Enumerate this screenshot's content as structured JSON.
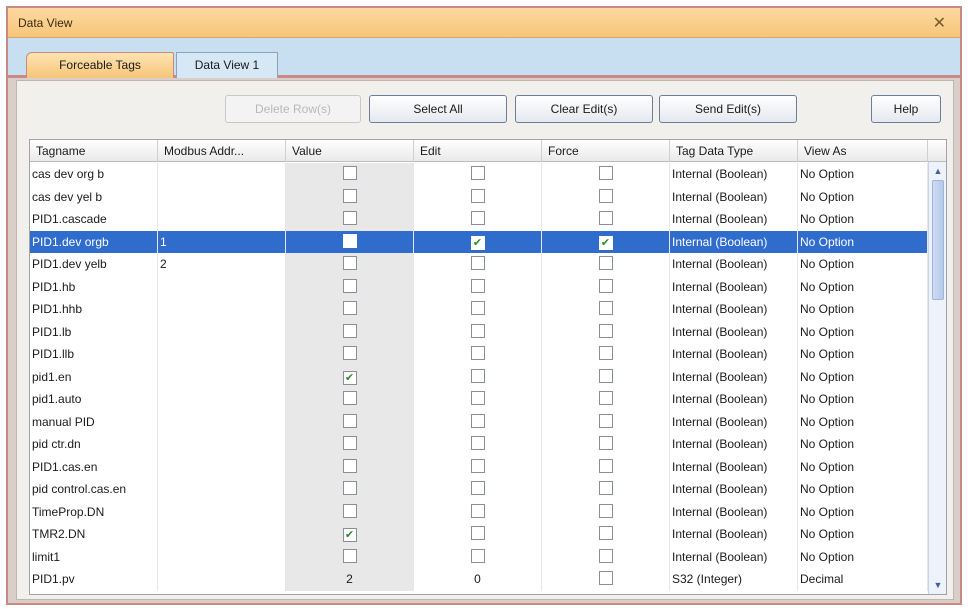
{
  "window": {
    "title": "Data View",
    "close_glyph": "✕"
  },
  "tabs": [
    {
      "label": "Forceable Tags"
    },
    {
      "label": "Data View 1"
    }
  ],
  "toolbar": {
    "delete_label": "Delete Row(s)",
    "select_all_label": "Select All",
    "clear_label": "Clear Edit(s)",
    "send_label": "Send Edit(s)",
    "help_label": "Help"
  },
  "table": {
    "columns": [
      "Tagname",
      "Modbus Addr...",
      "Value",
      "Edit",
      "Force",
      "Tag Data Type",
      "View As"
    ],
    "rows": [
      {
        "tag": "cas dev org b",
        "addr": "",
        "value": false,
        "edit": false,
        "force": false,
        "type": "Internal (Boolean)",
        "view": "No Option"
      },
      {
        "tag": "cas dev yel b",
        "addr": "",
        "value": false,
        "edit": false,
        "force": false,
        "type": "Internal (Boolean)",
        "view": "No Option"
      },
      {
        "tag": "PID1.cascade",
        "addr": "",
        "value": false,
        "edit": false,
        "force": false,
        "type": "Internal (Boolean)",
        "view": "No Option"
      },
      {
        "tag": "PID1.dev orgb",
        "addr": "1",
        "value": false,
        "edit": true,
        "force": true,
        "type": "Internal (Boolean)",
        "view": "No Option",
        "selected": true
      },
      {
        "tag": "PID1.dev yelb",
        "addr": "2",
        "value": false,
        "edit": false,
        "force": false,
        "type": "Internal (Boolean)",
        "view": "No Option"
      },
      {
        "tag": "PID1.hb",
        "addr": "",
        "value": false,
        "edit": false,
        "force": false,
        "type": "Internal (Boolean)",
        "view": "No Option"
      },
      {
        "tag": "PID1.hhb",
        "addr": "",
        "value": false,
        "edit": false,
        "force": false,
        "type": "Internal (Boolean)",
        "view": "No Option"
      },
      {
        "tag": "PID1.lb",
        "addr": "",
        "value": false,
        "edit": false,
        "force": false,
        "type": "Internal (Boolean)",
        "view": "No Option"
      },
      {
        "tag": "PID1.llb",
        "addr": "",
        "value": false,
        "edit": false,
        "force": false,
        "type": "Internal (Boolean)",
        "view": "No Option"
      },
      {
        "tag": "pid1.en",
        "addr": "",
        "value": true,
        "edit": false,
        "force": false,
        "type": "Internal (Boolean)",
        "view": "No Option"
      },
      {
        "tag": "pid1.auto",
        "addr": "",
        "value": false,
        "edit": false,
        "force": false,
        "type": "Internal (Boolean)",
        "view": "No Option"
      },
      {
        "tag": "manual PID",
        "addr": "",
        "value": false,
        "edit": false,
        "force": false,
        "type": "Internal (Boolean)",
        "view": "No Option"
      },
      {
        "tag": "pid ctr.dn",
        "addr": "",
        "value": false,
        "edit": false,
        "force": false,
        "type": "Internal (Boolean)",
        "view": "No Option"
      },
      {
        "tag": "PID1.cas.en",
        "addr": "",
        "value": false,
        "edit": false,
        "force": false,
        "type": "Internal (Boolean)",
        "view": "No Option"
      },
      {
        "tag": "pid control.cas.en",
        "addr": "",
        "value": false,
        "edit": false,
        "force": false,
        "type": "Internal (Boolean)",
        "view": "No Option"
      },
      {
        "tag": "TimeProp.DN",
        "addr": "",
        "value": false,
        "edit": false,
        "force": false,
        "type": "Internal (Boolean)",
        "view": "No Option"
      },
      {
        "tag": "TMR2.DN",
        "addr": "",
        "value": true,
        "edit": false,
        "force": false,
        "type": "Internal (Boolean)",
        "view": "No Option"
      },
      {
        "tag": "limit1",
        "addr": "",
        "value": false,
        "edit": false,
        "force": false,
        "type": "Internal (Boolean)",
        "view": "No Option"
      },
      {
        "tag": "PID1.pv",
        "addr": "",
        "value": "2",
        "edit": "0",
        "force": false,
        "type": "S32 (Integer)",
        "view": "Decimal"
      }
    ]
  },
  "icons": {
    "check": "✔",
    "scroll_up": "▲",
    "scroll_down": "▼"
  }
}
